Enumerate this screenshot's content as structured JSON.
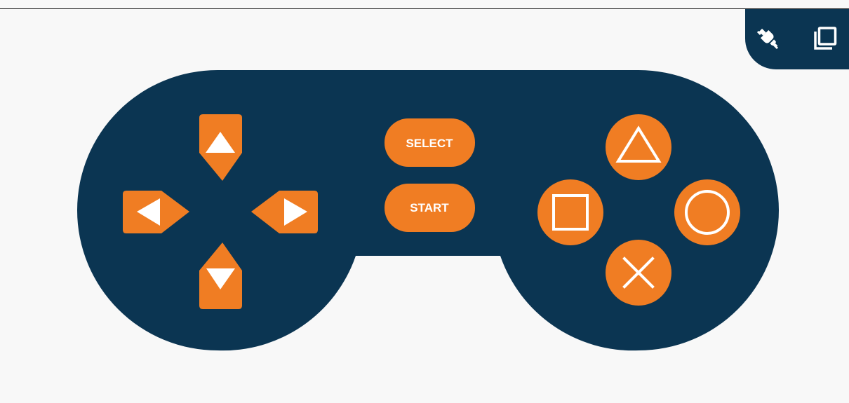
{
  "colors": {
    "background": "#f8f8f8",
    "controller_body": "#0b3552",
    "button_fill": "#f07d23",
    "glyph": "#ffffff"
  },
  "toolbar": {
    "connect_icon": "plug-connect-icon",
    "window_icon": "copy-window-icon"
  },
  "center_buttons": {
    "select_label": "SELECT",
    "start_label": "START"
  },
  "dpad": [
    "up",
    "left",
    "right",
    "down"
  ],
  "action_buttons": [
    "triangle",
    "square",
    "circle",
    "cross"
  ]
}
